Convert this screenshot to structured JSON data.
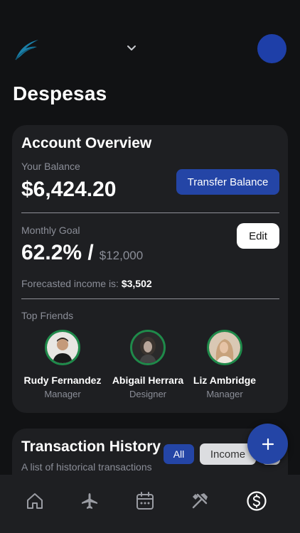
{
  "header": {
    "logo_icon": "feather-logo-icon",
    "dropdown_icon": "chevron-down-icon",
    "accent": "#1e3fa8"
  },
  "page": {
    "title": "Despesas"
  },
  "account_overview": {
    "title": "Account Overview",
    "balance_label": "Your Balance",
    "balance_value": "$6,424.20",
    "transfer_label": "Transfer Balance",
    "goal_label": "Monthly Goal",
    "goal_percent": "62.2% /",
    "goal_target": "$12,000",
    "edit_label": "Edit",
    "forecast_label": "Forecasted income is: ",
    "forecast_value": "$3,502",
    "friends_label": "Top Friends",
    "friends": [
      {
        "name": "Rudy Fernandez",
        "role": "Manager"
      },
      {
        "name": "Abigail Herrara",
        "role": "Designer"
      },
      {
        "name": "Liz Ambridge",
        "role": "Manager"
      }
    ]
  },
  "transactions": {
    "title": "Transaction History",
    "subtitle": "A list of historical transactions",
    "filters": [
      "All",
      "Income"
    ]
  },
  "fab": {
    "icon": "plus-icon"
  },
  "nav": {
    "items": [
      "home-icon",
      "airplane-icon",
      "calendar-icon",
      "tools-icon",
      "dollar-icon"
    ],
    "active": "dollar-icon"
  },
  "colors": {
    "background": "#111214",
    "card": "#1e1f22",
    "primary": "#2445a6",
    "friend_ring": "#1f8a4a"
  }
}
